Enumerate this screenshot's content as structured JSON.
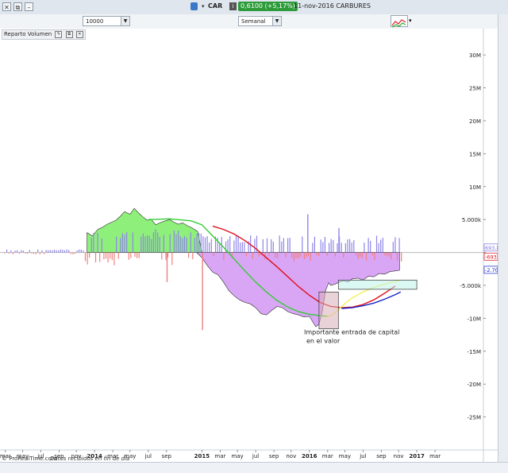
{
  "topbar": {
    "symbol": "CAR",
    "quote": "0,6100 (+5,17%)",
    "date_name": "11-nov-2016 CARBURES"
  },
  "toolbar": {
    "units": "10000 unidades",
    "period": "Semanal"
  },
  "indicator": {
    "name": "Reparto Volumen"
  },
  "footer": {
    "source": "© ProRealTime.com",
    "note": "Datos recibidos en fin de día"
  },
  "colors": {
    "positive_fill": "#8ef07a",
    "negative_fill": "#d9a6f5",
    "pos_bar": "#8f86e8",
    "neg_bar": "#f07f7f",
    "green_line": "#33cc33",
    "red_line": "#e0101b",
    "yellow_line": "#f3f15a",
    "blue_line": "#1524c7",
    "annotation_box_pink": "#d8aeb8",
    "annotation_box_cyan": "#bff3ea"
  },
  "chart_data": {
    "type": "area",
    "title": "Reparto Volumen",
    "ylim": [
      -30000000,
      34000000
    ],
    "y_ticks": [
      {
        "value": 30000000,
        "label": "30M"
      },
      {
        "value": 25000000,
        "label": "25M"
      },
      {
        "value": 20000000,
        "label": "20M"
      },
      {
        "value": 15000000,
        "label": "15M"
      },
      {
        "value": 10000000,
        "label": "10M"
      },
      {
        "value": 5000000,
        "label": "5.000k"
      },
      {
        "value": 0,
        "label": "0"
      },
      {
        "value": -5000000,
        "label": "-5.000k"
      },
      {
        "value": -10000000,
        "label": "-10M"
      },
      {
        "value": -15000000,
        "label": "-15M"
      },
      {
        "value": -20000000,
        "label": "-20M"
      },
      {
        "value": -25000000,
        "label": "-25M"
      }
    ],
    "value_labels": [
      {
        "value": 693865,
        "label": "693.865",
        "color": "#7b6fe0"
      },
      {
        "value": -2703000,
        "label": "-2.703k",
        "color": "#1524c7"
      },
      {
        "value": -693865,
        "label": "-693.865",
        "color": "#e0101b"
      }
    ],
    "xlim": [
      2013.12,
      2017.62
    ],
    "x_ticks": [
      {
        "x": 2013.17,
        "label": "mar"
      },
      {
        "x": 2013.33,
        "label": "may"
      },
      {
        "x": 2013.5,
        "label": "jul"
      },
      {
        "x": 2013.67,
        "label": "sep"
      },
      {
        "x": 2013.83,
        "label": "nov"
      },
      {
        "x": 2014.0,
        "label": "2014",
        "bold": true
      },
      {
        "x": 2014.17,
        "label": "mar"
      },
      {
        "x": 2014.33,
        "label": "may"
      },
      {
        "x": 2014.5,
        "label": "jul"
      },
      {
        "x": 2014.67,
        "label": "sep"
      },
      {
        "x": 2015.0,
        "label": "2015",
        "bold": true
      },
      {
        "x": 2015.17,
        "label": "mar"
      },
      {
        "x": 2015.33,
        "label": "may"
      },
      {
        "x": 2015.5,
        "label": "jul"
      },
      {
        "x": 2015.67,
        "label": "sep"
      },
      {
        "x": 2015.83,
        "label": "nov"
      },
      {
        "x": 2016.0,
        "label": "2016",
        "bold": true
      },
      {
        "x": 2016.17,
        "label": "mar"
      },
      {
        "x": 2016.33,
        "label": "may"
      },
      {
        "x": 2016.5,
        "label": "jul"
      },
      {
        "x": 2016.67,
        "label": "sep"
      },
      {
        "x": 2016.83,
        "label": "nov"
      },
      {
        "x": 2017.0,
        "label": "2017",
        "bold": true
      },
      {
        "x": 2017.17,
        "label": "mar"
      }
    ],
    "series": [
      {
        "name": "Volumen acumulado positivo",
        "x": [
          2013.93,
          2013.98,
          2014.03,
          2014.07,
          2014.12,
          2014.16,
          2014.2,
          2014.24,
          2014.28,
          2014.33,
          2014.37,
          2014.41,
          2014.45,
          2014.49,
          2014.53,
          2014.57,
          2014.62,
          2014.66,
          2014.7,
          2014.74,
          2014.78,
          2014.82,
          2014.86,
          2014.9,
          2014.96,
          2015.0
        ],
        "values": [
          3000000,
          2500000,
          3500000,
          3800000,
          4300000,
          4600000,
          4900000,
          5500000,
          6200000,
          5800000,
          6700000,
          6000000,
          5400000,
          4900000,
          5000000,
          4200000,
          4600000,
          4800000,
          5000000,
          4600000,
          4300000,
          4500000,
          4100000,
          3800000,
          3200000,
          0
        ]
      },
      {
        "name": "Volumen acumulado negativo",
        "x": [
          2014.95,
          2015.0,
          2015.05,
          2015.1,
          2015.15,
          2015.2,
          2015.25,
          2015.3,
          2015.35,
          2015.4,
          2015.45,
          2015.5,
          2015.55,
          2015.6,
          2015.65,
          2015.7,
          2015.75,
          2015.8,
          2015.85,
          2015.9,
          2015.95,
          2016.0,
          2016.03,
          2016.06,
          2016.09,
          2016.12,
          2016.15,
          2016.18,
          2016.2,
          2016.24,
          2016.28,
          2016.32,
          2016.36,
          2016.4,
          2016.45,
          2016.5,
          2016.55,
          2016.6,
          2016.65,
          2016.7,
          2016.75,
          2016.8,
          2016.84
        ],
        "values": [
          0,
          -800000,
          -2000000,
          -3000000,
          -3400000,
          -4500000,
          -5800000,
          -6600000,
          -7200000,
          -7600000,
          -7800000,
          -8400000,
          -9300000,
          -9500000,
          -8800000,
          -8200000,
          -8400000,
          -9000000,
          -9300000,
          -9500000,
          -9800000,
          -9700000,
          -10500000,
          -11300000,
          -10900000,
          -9000000,
          -5800000,
          -4600000,
          -5000000,
          -4800000,
          -4500000,
          -4300000,
          -4500000,
          -4000000,
          -3900000,
          -4200000,
          -3600000,
          -3700000,
          -3200000,
          -3300000,
          -2900000,
          -2800000,
          -2700000
        ]
      },
      {
        "name": "Media verde",
        "x": [
          2014.5,
          2014.7,
          2014.9,
          2015.0,
          2015.1,
          2015.2,
          2015.3,
          2015.4,
          2015.5,
          2015.6,
          2015.7,
          2015.8,
          2015.9,
          2016.0,
          2016.1,
          2016.18
        ],
        "values": [
          5000000,
          5100000,
          4800000,
          4200000,
          2500000,
          800000,
          -1000000,
          -2800000,
          -4500000,
          -6000000,
          -7300000,
          -8300000,
          -9000000,
          -9400000,
          -9600000,
          -9700000
        ]
      },
      {
        "name": "Media roja",
        "x": [
          2015.1,
          2015.2,
          2015.3,
          2015.4,
          2015.5,
          2015.6,
          2015.7,
          2015.8,
          2015.9,
          2016.0,
          2016.1,
          2016.2,
          2016.3,
          2016.4,
          2016.5,
          2016.6,
          2016.7,
          2016.8
        ],
        "values": [
          4000000,
          3500000,
          2800000,
          1800000,
          600000,
          -800000,
          -2200000,
          -3700000,
          -5200000,
          -6500000,
          -7600000,
          -8200000,
          -8400000,
          -8300000,
          -7900000,
          -7200000,
          -6200000,
          -5100000
        ]
      },
      {
        "name": "Media amarilla",
        "x": [
          2016.15,
          2016.2,
          2016.25,
          2016.3,
          2016.35,
          2016.4,
          2016.5,
          2016.6,
          2016.7,
          2016.8,
          2016.85
        ],
        "values": [
          -9800000,
          -9600000,
          -9000000,
          -8200000,
          -7500000,
          -6900000,
          -6000000,
          -5300000,
          -4800000,
          -4400000,
          -4200000
        ]
      },
      {
        "name": "Media azul",
        "x": [
          2016.3,
          2016.4,
          2016.5,
          2016.6,
          2016.7,
          2016.8,
          2016.85
        ],
        "values": [
          -8500000,
          -8400000,
          -8100000,
          -7700000,
          -7100000,
          -6400000,
          -6000000
        ]
      }
    ],
    "annotations": [
      {
        "text_lines": [
          "Importante entrada de capital",
          "en el valor"
        ],
        "x": 2015.95,
        "y": -12400000
      },
      {
        "box": "pink",
        "x0": 2016.09,
        "x1": 2016.27,
        "y0": -11600000,
        "y1": -6000000
      },
      {
        "box": "cyan",
        "x0": 2016.27,
        "x1": 2017.0,
        "y0": -5600000,
        "y1": -4200000
      }
    ],
    "grid": false,
    "zero_line": true
  }
}
